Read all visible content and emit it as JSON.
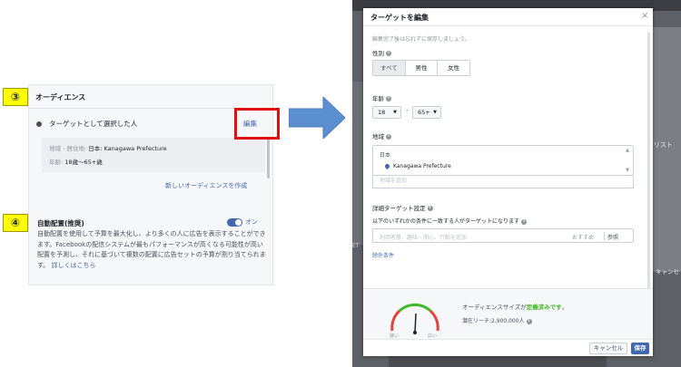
{
  "left": {
    "badge_3": "③",
    "badge_4": "④",
    "audience_title": "オーディエンス",
    "radio_label": "ターゲットとして選択した人",
    "edit_label": "編集",
    "location_label": "地域 - 居住地:",
    "location_value": "日本: Kanagawa Prefecture",
    "age_label": "年齢:",
    "age_value": "18歳〜65+歳",
    "new_audience_link": "新しいオーディエンスを作成",
    "auto_placement_title": "自動配置(推奨)",
    "toggle_label": "オン",
    "auto_placement_desc": "自動配置を使用して予算を最大化し、より多くの人に広告を表示することができます。Facebookの配信システムが最もパフォーマンスが高くなる可能性が高い配置を予測し、それに基づいて複数の配置に広告セットの予算が割り当てられます。",
    "learn_more": "詳しくはこちら"
  },
  "background": {
    "right_text": "#リスト",
    "right_text2": "キャンセ",
    "left_text": "ET"
  },
  "modal": {
    "title": "ターゲットを編集",
    "close": "×",
    "note": "編集完了後は忘れずに保存しましょう。",
    "gender_label": "性別",
    "gender_options": [
      "すべて",
      "男性",
      "女性"
    ],
    "age_label": "年齢",
    "age_min": "18",
    "age_max": "65+",
    "age_dash": "-",
    "location_label": "地域",
    "location_country": "日本",
    "location_pref": "Kanagawa Prefecture",
    "location_add_placeholder": "地域を追加",
    "detail_label": "詳細ターゲット設定",
    "detail_sub": "以下のいずれかの条件に一致する人がターゲットになります",
    "detail_placeholder": "利用者層、趣味・関心、行動を追加",
    "detail_suggest": "おすすめ",
    "detail_browse": "参照",
    "exclude_link": "除外条件",
    "gauge_narrow": "狭い",
    "gauge_wide": "広い",
    "size_prefix": "オーディエンスサイズが",
    "size_status": "定義済みです",
    "size_suffix": "。",
    "reach": "潜在リーチ:2,900,000人",
    "cancel": "キャンセル",
    "save": "保存"
  },
  "colors": {
    "fb_blue": "#4267b2",
    "highlight_red": "#e01010",
    "badge_yellow": "#ffff00",
    "arrow_blue": "#5b8fd0",
    "ok_green": "#42b72a"
  }
}
